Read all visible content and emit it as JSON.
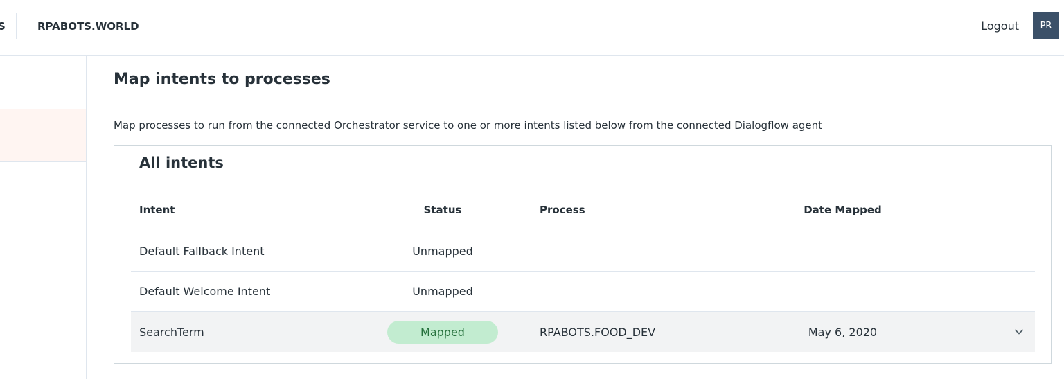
{
  "header": {
    "partial_text": "S",
    "brand": "RPABOTS.WORLD",
    "logout_label": "Logout",
    "avatar_initials": "PR"
  },
  "page": {
    "title": "Map intents to processes",
    "description": "Map processes to run from the connected Orchestrator service to one or more intents listed below from the connected Dialogflow agent"
  },
  "card": {
    "title": "All intents",
    "columns": {
      "intent": "Intent",
      "status": "Status",
      "process": "Process",
      "date_mapped": "Date Mapped"
    },
    "rows": [
      {
        "intent": "Default Fallback Intent",
        "status": "Unmapped",
        "process": "",
        "date_mapped": ""
      },
      {
        "intent": "Default Welcome Intent",
        "status": "Unmapped",
        "process": "",
        "date_mapped": ""
      },
      {
        "intent": "SearchTerm",
        "status": "Mapped",
        "process": "RPABOTS.FOOD_DEV",
        "date_mapped": "May 6, 2020"
      }
    ]
  },
  "colors": {
    "mapped_badge_bg": "#c2ecd0",
    "mapped_badge_text": "#26713d",
    "active_nav_bg": "#fff5f2",
    "avatar_bg": "#3b5068"
  },
  "icons": {
    "expand_row": "chevron-down-icon"
  }
}
